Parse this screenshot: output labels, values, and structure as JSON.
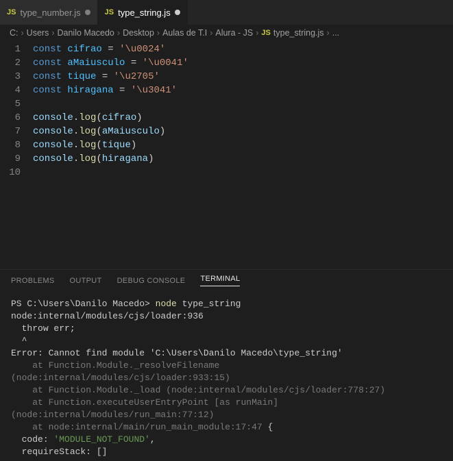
{
  "tabs": {
    "inactive": {
      "icon": "JS",
      "label": "type_number.js"
    },
    "active": {
      "icon": "JS",
      "label": "type_string.js"
    }
  },
  "breadcrumbs": {
    "parts": [
      "C:",
      "Users",
      "Danilo Macedo",
      "Desktop",
      "Aulas de T.I",
      "Alura - JS"
    ],
    "fileIcon": "JS",
    "file": "type_string.js",
    "tail": "..."
  },
  "code": {
    "lines": [
      {
        "n": "1",
        "kw": "const ",
        "var": "cifrao",
        "mid": " = ",
        "str": "'\\u0024'"
      },
      {
        "n": "2",
        "kw": "const ",
        "var": "aMaiusculo",
        "mid": " = ",
        "str": "'\\u0041'"
      },
      {
        "n": "3",
        "kw": "const ",
        "var": "tique",
        "mid": " = ",
        "str": "'\\u2705'"
      },
      {
        "n": "4",
        "kw": "const ",
        "var": "hiragana",
        "mid": " = ",
        "str": "'\\u3041'"
      },
      {
        "n": "5",
        "blank": true
      },
      {
        "n": "6",
        "obj": "console",
        "dot": ".",
        "fn": "log",
        "open": "(",
        "arg": "cifrao",
        "close": ")"
      },
      {
        "n": "7",
        "obj": "console",
        "dot": ".",
        "fn": "log",
        "open": "(",
        "arg": "aMaiusculo",
        "close": ")"
      },
      {
        "n": "8",
        "obj": "console",
        "dot": ".",
        "fn": "log",
        "open": "(",
        "arg": "tique",
        "close": ")"
      },
      {
        "n": "9",
        "obj": "console",
        "dot": ".",
        "fn": "log",
        "open": "(",
        "arg": "hiragana",
        "close": ")"
      },
      {
        "n": "10",
        "blank": true
      }
    ]
  },
  "panel": {
    "tabs": {
      "problems": "PROBLEMS",
      "output": "OUTPUT",
      "debug": "DEBUG CONSOLE",
      "terminal": "TERMINAL"
    }
  },
  "terminal": {
    "promptPrefix": "PS C:\\Users\\Danilo Macedo> ",
    "cmdBin": "node ",
    "cmdArg": "type_string",
    "l2": "node:internal/modules/cjs/loader:936",
    "l3": "  throw err;",
    "l4": "  ^",
    "blank": "",
    "errHead": "Error: Cannot find module 'C:\\Users\\Danilo Macedo\\type_string'",
    "s1": "    at Function.Module._resolveFilename (node:internal/modules/cjs/loader:933:15)",
    "s2": "    at Function.Module._load (node:internal/modules/cjs/loader:778:27)",
    "s3": "    at Function.executeUserEntryPoint [as runMain] (node:internal/modules/run_main:77:12)",
    "s4pre": "    at node:internal/main/run_main_module:17:47",
    "s4brace": " {",
    "codeLabel": "  code: ",
    "codeVal": "'MODULE_NOT_FOUND'",
    "codeComma": ",",
    "reqStack": "  requireStack: []"
  }
}
